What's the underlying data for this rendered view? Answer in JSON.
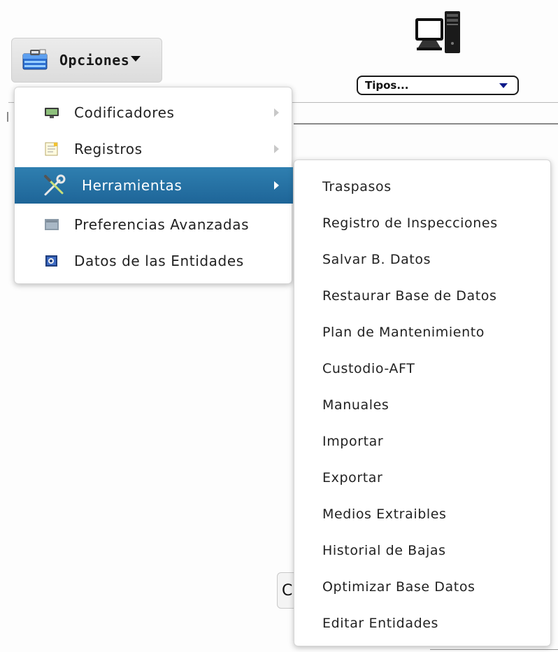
{
  "toolbar": {
    "opciones_label": "Opciones",
    "tipos_label": "Tipos...",
    "computer_icon": "computer-icon"
  },
  "menu": {
    "items": [
      {
        "label": "Codificadores",
        "icon": "codificadores-icon",
        "has_submenu": true
      },
      {
        "label": "Registros",
        "icon": "registros-icon",
        "has_submenu": true
      },
      {
        "label": "Herramientas",
        "icon": "tools-icon",
        "has_submenu": true,
        "active": true
      },
      {
        "label": "Preferencias Avanzadas",
        "icon": "preferences-icon",
        "has_submenu": false
      },
      {
        "label": "Datos de las Entidades",
        "icon": "entities-icon",
        "has_submenu": false
      }
    ]
  },
  "submenu": {
    "items": [
      "Traspasos",
      "Registro de Inspecciones",
      "Salvar B. Datos",
      "Restaurar Base de Datos",
      "Plan de Mantenimiento",
      "Custodio-AFT",
      "Manuales",
      "Importar",
      "Exportar",
      "Medios Extraibles",
      "Historial de Bajas",
      "Optimizar Base Datos",
      "Editar Entidades"
    ]
  },
  "background": {
    "partial_button_text": "C"
  },
  "colors": {
    "active_item_bg": "#1e6598",
    "select_caret": "#0b1a8a"
  }
}
